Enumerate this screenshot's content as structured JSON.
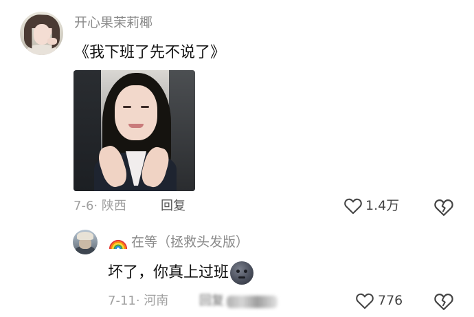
{
  "comment1": {
    "username": "开心果茉莉椰",
    "text": "《我下班了先不说了》",
    "date_location": "7-6· 陕西",
    "reply_label": "回复",
    "like_count": "1.4万",
    "icons": {
      "like": "heart-outline-icon",
      "dislike": "broken-heart-icon"
    }
  },
  "comment2": {
    "username": "在等（拯救头发版）",
    "username_emoji": "rainbow-icon",
    "text": "坏了，你真上过班",
    "text_emoji": "new-moon-face-icon",
    "date_location": "7-11· 河南",
    "reply_label": "回复",
    "like_count": "776",
    "icons": {
      "like": "heart-outline-icon",
      "dislike": "broken-heart-icon"
    }
  }
}
